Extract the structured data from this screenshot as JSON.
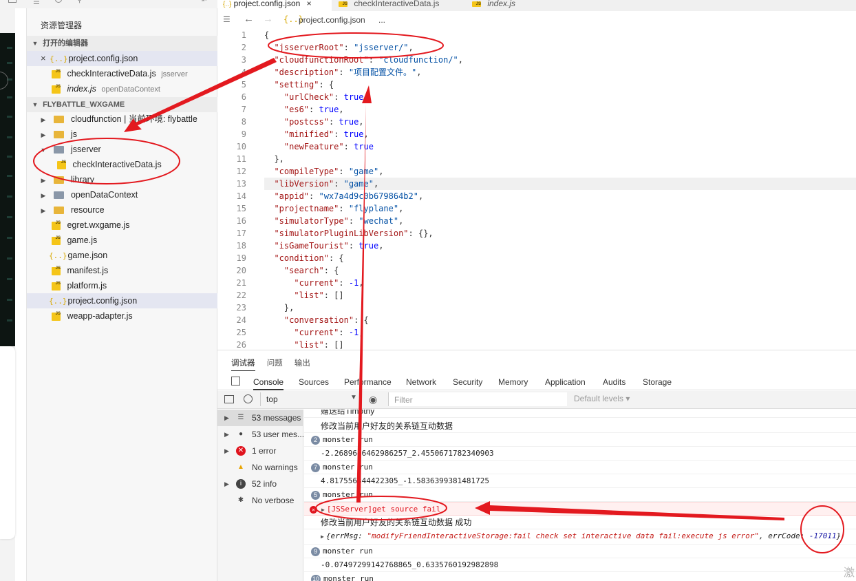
{
  "explorer": {
    "title": "资源管理器",
    "open_editors_label": "打开的编辑器",
    "open_editors": [
      {
        "name": "project.config.json",
        "desc": "",
        "icon": "json"
      },
      {
        "name": "checkInteractiveData.js",
        "desc": "jsserver",
        "icon": "js"
      },
      {
        "name": "index.js",
        "desc": "openDataContext",
        "icon": "js"
      }
    ],
    "project_label": "FLYBATTLE_WXGAME",
    "tree": [
      {
        "name": "cloudfunction | 当前环境: flybattle",
        "type": "folder"
      },
      {
        "name": "js",
        "type": "folder"
      },
      {
        "name": "jsserver",
        "type": "folder-open"
      },
      {
        "name": "checkInteractiveData.js",
        "type": "js"
      },
      {
        "name": "library",
        "type": "folder"
      },
      {
        "name": "openDataContext",
        "type": "folder"
      },
      {
        "name": "resource",
        "type": "folder"
      },
      {
        "name": "egret.wxgame.js",
        "type": "js"
      },
      {
        "name": "game.js",
        "type": "js"
      },
      {
        "name": "game.json",
        "type": "json"
      },
      {
        "name": "manifest.js",
        "type": "js"
      },
      {
        "name": "platform.js",
        "type": "js"
      },
      {
        "name": "project.config.json",
        "type": "json"
      },
      {
        "name": "weapp-adapter.js",
        "type": "js"
      }
    ]
  },
  "tabs": [
    {
      "label": "project.config.json"
    },
    {
      "label": "checkInteractiveData.js"
    },
    {
      "label": "index.js"
    }
  ],
  "breadcrumb": {
    "file": "project.config.json",
    "rest": "..."
  },
  "code_lines": [
    {
      "n": "1",
      "text": "{"
    },
    {
      "n": "2",
      "text": "  \"jsserverRoot\": \"jsserver/\","
    },
    {
      "n": "3",
      "text": "  \"cloudfunctionRoot\": \"cloudfunction/\","
    },
    {
      "n": "4",
      "text": "  \"description\": \"项目配置文件。\","
    },
    {
      "n": "5",
      "text": "  \"setting\": {"
    },
    {
      "n": "6",
      "text": "    \"urlCheck\": true,"
    },
    {
      "n": "7",
      "text": "    \"es6\": true,"
    },
    {
      "n": "8",
      "text": "    \"postcss\": true,"
    },
    {
      "n": "9",
      "text": "    \"minified\": true,"
    },
    {
      "n": "10",
      "text": "    \"newFeature\": true"
    },
    {
      "n": "11",
      "text": "  },"
    },
    {
      "n": "12",
      "text": "  \"compileType\": \"game\","
    },
    {
      "n": "13",
      "text": "  \"libVersion\": \"game\","
    },
    {
      "n": "14",
      "text": "  \"appid\": \"wx7a4d9c0b679864b2\","
    },
    {
      "n": "15",
      "text": "  \"projectname\": \"flyplane\","
    },
    {
      "n": "16",
      "text": "  \"simulatorType\": \"wechat\","
    },
    {
      "n": "17",
      "text": "  \"simulatorPluginLibVersion\": {},"
    },
    {
      "n": "18",
      "text": "  \"isGameTourist\": true,"
    },
    {
      "n": "19",
      "text": "  \"condition\": {"
    },
    {
      "n": "20",
      "text": "    \"search\": {"
    },
    {
      "n": "21",
      "text": "      \"current\": -1,"
    },
    {
      "n": "22",
      "text": "      \"list\": []"
    },
    {
      "n": "23",
      "text": "    },"
    },
    {
      "n": "24",
      "text": "    \"conversation\": {"
    },
    {
      "n": "25",
      "text": "      \"current\": -1,"
    },
    {
      "n": "26",
      "text": "      \"list\": []"
    }
  ],
  "panel": {
    "tabs": [
      "调试器",
      "问题",
      "输出"
    ],
    "devtools_tabs": [
      "Console",
      "Sources",
      "Performance",
      "Network",
      "Security",
      "Memory",
      "Application",
      "Audits",
      "Storage"
    ],
    "context": "top",
    "filter_placeholder": "Filter",
    "levels": "Default levels ▾",
    "sidebar": [
      {
        "label": "53 messages",
        "icon": "list-icon"
      },
      {
        "label": "53 user mes...",
        "icon": "user-icon"
      },
      {
        "label": "1 error",
        "icon": "error-icon"
      },
      {
        "label": "No warnings",
        "icon": "warning-icon"
      },
      {
        "label": "52 info",
        "icon": "info-icon"
      },
      {
        "label": "No verbose",
        "icon": "bug-icon"
      }
    ],
    "log": [
      {
        "text": "赠送给Timothy",
        "kind": "cn",
        "badge": ""
      },
      {
        "text": "修改当前用户好友的关系链互动数据",
        "kind": "cn",
        "badge": ""
      },
      {
        "text": "monster run",
        "kind": "mono",
        "badge": "2"
      },
      {
        "text": "-2.2689646462986257_2.4550671782340903",
        "kind": "mono",
        "badge": ""
      },
      {
        "text": "monster run",
        "kind": "mono",
        "badge": "7"
      },
      {
        "text": "4.817556344422305_-1.5836399381481725",
        "kind": "mono",
        "badge": ""
      },
      {
        "text": "monster run",
        "kind": "mono",
        "badge": "5"
      },
      {
        "text": "[JSServer]get source fail",
        "kind": "err",
        "badge": ""
      },
      {
        "text": "修改当前用户好友的关系链互动数据 成功",
        "kind": "cn",
        "badge": ""
      },
      {
        "text": "obj",
        "kind": "obj",
        "badge": ""
      },
      {
        "text": "monster run",
        "kind": "mono",
        "badge": "9"
      },
      {
        "text": "-0.07497299142768865_0.6335760192982898",
        "kind": "mono",
        "badge": ""
      },
      {
        "text": "monster run",
        "kind": "mono",
        "badge": "10"
      }
    ],
    "obj": {
      "prefix": "{errMsg: ",
      "msg": "\"modifyFriendInteractiveStorage:fail check set interactive data fail:execute js error\"",
      "mid": ", errCode: ",
      "code": "-17011",
      "suffix": "}"
    }
  },
  "watermark": "激"
}
